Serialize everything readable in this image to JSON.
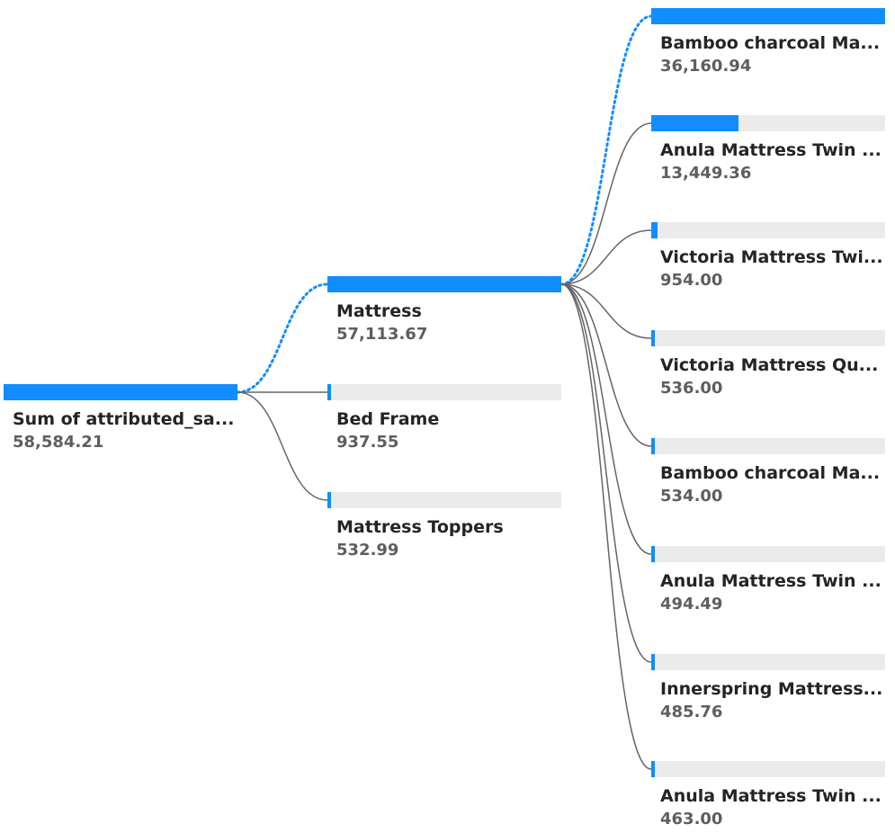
{
  "colors": {
    "accent": "#118dff",
    "track": "#ebebeb",
    "link": "#666666",
    "label": "#252423",
    "value": "#605e5c"
  },
  "root": {
    "label": "Sum of attributed_sa...",
    "value": "58,584.21",
    "amount": 58584.21
  },
  "level1": [
    {
      "label": "Mattress",
      "value": "57,113.67",
      "amount": 57113.67,
      "expanded": true
    },
    {
      "label": "Bed Frame",
      "value": "937.55",
      "amount": 937.55
    },
    {
      "label": "Mattress Toppers",
      "value": "532.99",
      "amount": 532.99
    }
  ],
  "level2": [
    {
      "label": "Bamboo charcoal Ma...",
      "value": "36,160.94",
      "amount": 36160.94,
      "selected": true
    },
    {
      "label": "Anula Mattress Twin ...",
      "value": "13,449.36",
      "amount": 13449.36
    },
    {
      "label": "Victoria Mattress Twi...",
      "value": "954.00",
      "amount": 954.0
    },
    {
      "label": "Victoria Mattress Qu...",
      "value": "536.00",
      "amount": 536.0
    },
    {
      "label": "Bamboo charcoal Ma...",
      "value": "534.00",
      "amount": 534.0
    },
    {
      "label": "Anula Mattress Twin ...",
      "value": "494.49",
      "amount": 494.49
    },
    {
      "label": "Innerspring Mattress...",
      "value": "485.76",
      "amount": 485.76
    },
    {
      "label": "Anula Mattress Twin ...",
      "value": "463.00",
      "amount": 463.0
    }
  ]
}
